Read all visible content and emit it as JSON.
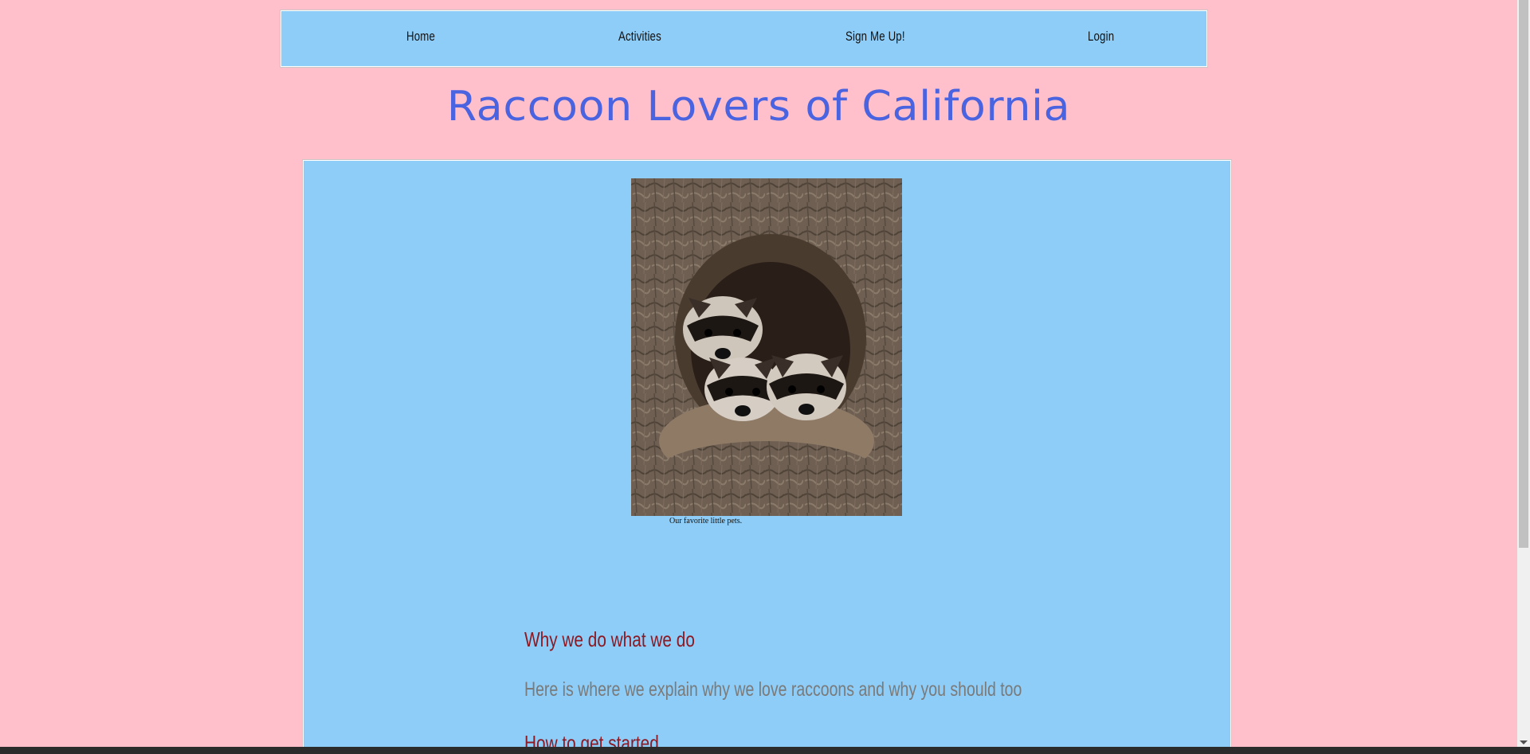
{
  "nav": {
    "items": [
      {
        "label": "Home"
      },
      {
        "label": "Activities"
      },
      {
        "label": "Sign Me Up!"
      },
      {
        "label": "Login"
      }
    ]
  },
  "header": {
    "title": "Raccoon Lovers of California"
  },
  "main": {
    "figure": {
      "caption": "Our favorite little pets."
    },
    "sections": [
      {
        "heading": "Why we do what we do",
        "text": "Here is where we explain why we love raccoons and why you should too"
      },
      {
        "heading": "How to get started"
      }
    ]
  },
  "colors": {
    "page_background": "#ffc0cb",
    "panel_background": "#8ecdf7",
    "title": "#4a63e0",
    "heading": "#8b1a24",
    "body_text": "#7a7a7a"
  }
}
